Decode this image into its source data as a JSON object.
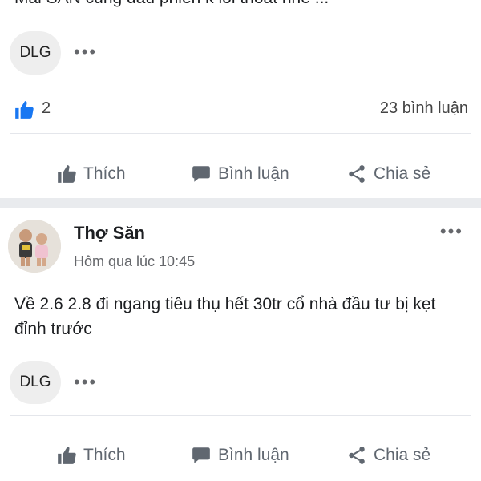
{
  "prev_post": {
    "truncated_text": "Mải SĂN cũng đầu phiên k lỗi thoát nhé ...",
    "tag_label": "DLG",
    "more_label": "•••",
    "reaction_count": "2",
    "comment_count": "23 bình luận"
  },
  "actions": {
    "like": "Thích",
    "comment": "Bình luận",
    "share": "Chia sẻ"
  },
  "post": {
    "author": "Thợ Săn",
    "timestamp": "Hôm qua lúc 10:45",
    "more_label": "•••",
    "body": "Về 2.6 2.8 đi ngang tiêu thụ hết 30tr cổ nhà đầu tư bị kẹt đỉnh trước",
    "tag_label": "DLG",
    "tag_more_label": "•••"
  },
  "colors": {
    "like_blue": "#1877f2",
    "icon_gray": "#606770",
    "separator": "#e9ebee"
  }
}
